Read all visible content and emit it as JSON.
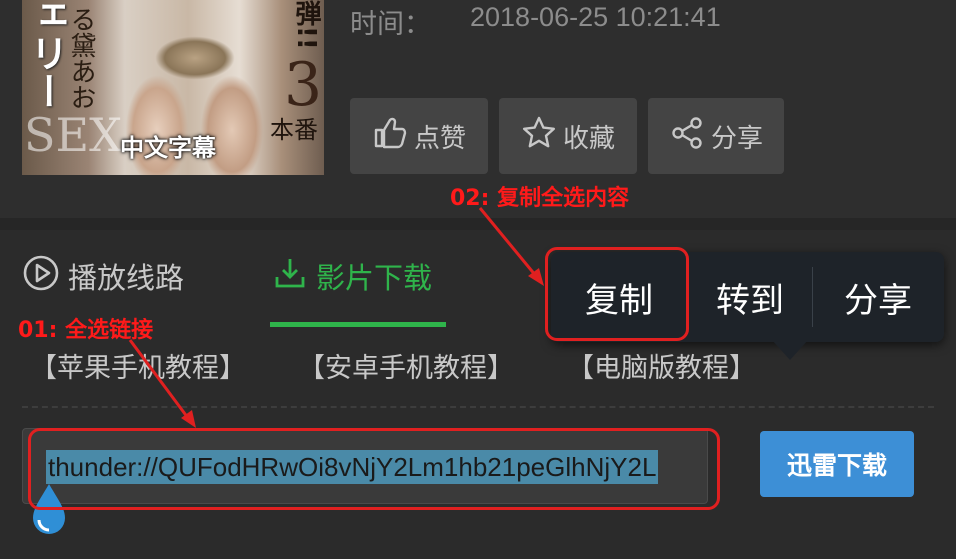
{
  "poster": {
    "text_jp_left": "ェリー",
    "text_jp_name": "る黛あお",
    "text_sex": "SEX",
    "text_num": "3",
    "text_right_top": "弾!!",
    "text_right_bottom": "本番",
    "caption": "中文字幕"
  },
  "meta": {
    "time_label": "时间：",
    "time_value": "2018-06-25 10:21:41"
  },
  "actions": {
    "like_label": "点赞",
    "favorite_label": "收藏",
    "share_label": "分享"
  },
  "tabs": {
    "play_label": "播放线路",
    "download_label": "影片下载"
  },
  "tutorials": {
    "apple": "【苹果手机教程】",
    "android": "【安卓手机教程】",
    "pc": "【电脑版教程】"
  },
  "download": {
    "url": "thunder://QUFodHRwOi8vNjY2Lm1hb21peGlhNjY2L",
    "xunlei_label": "迅雷下载"
  },
  "context_menu": {
    "copy": "复制",
    "goto": "转到",
    "share": "分享"
  },
  "annotations": {
    "step1": "01: 全选链接",
    "step2": "02: 复制全选内容",
    "color": "#ff1a1a"
  },
  "colors": {
    "accent_green": "#2fb44b",
    "button_blue": "#3d8fd6",
    "selection_blue": "#4a8aa8"
  }
}
